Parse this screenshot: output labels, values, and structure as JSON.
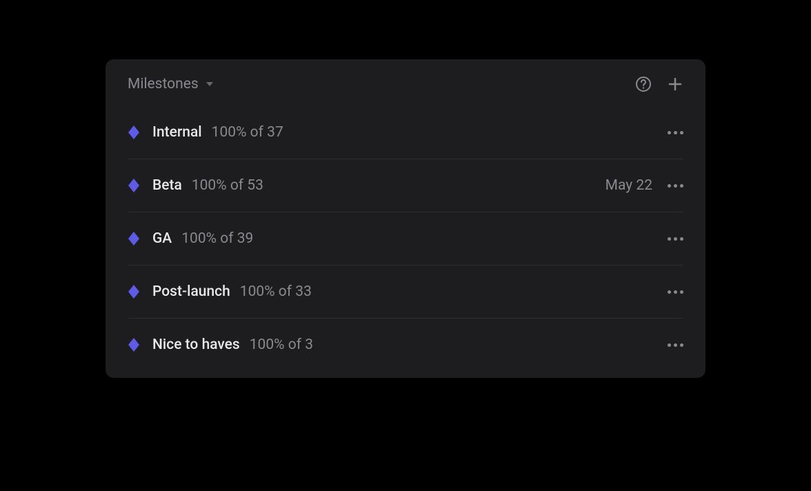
{
  "header": {
    "title": "Milestones"
  },
  "milestones": [
    {
      "name": "Internal",
      "progress": "100% of 37",
      "date": ""
    },
    {
      "name": "Beta",
      "progress": "100% of 53",
      "date": "May 22"
    },
    {
      "name": "GA",
      "progress": "100% of 39",
      "date": ""
    },
    {
      "name": "Post-launch",
      "progress": "100% of 33",
      "date": ""
    },
    {
      "name": "Nice to haves",
      "progress": "100% of 3",
      "date": ""
    }
  ],
  "colors": {
    "diamond": "#5e5ce6"
  }
}
